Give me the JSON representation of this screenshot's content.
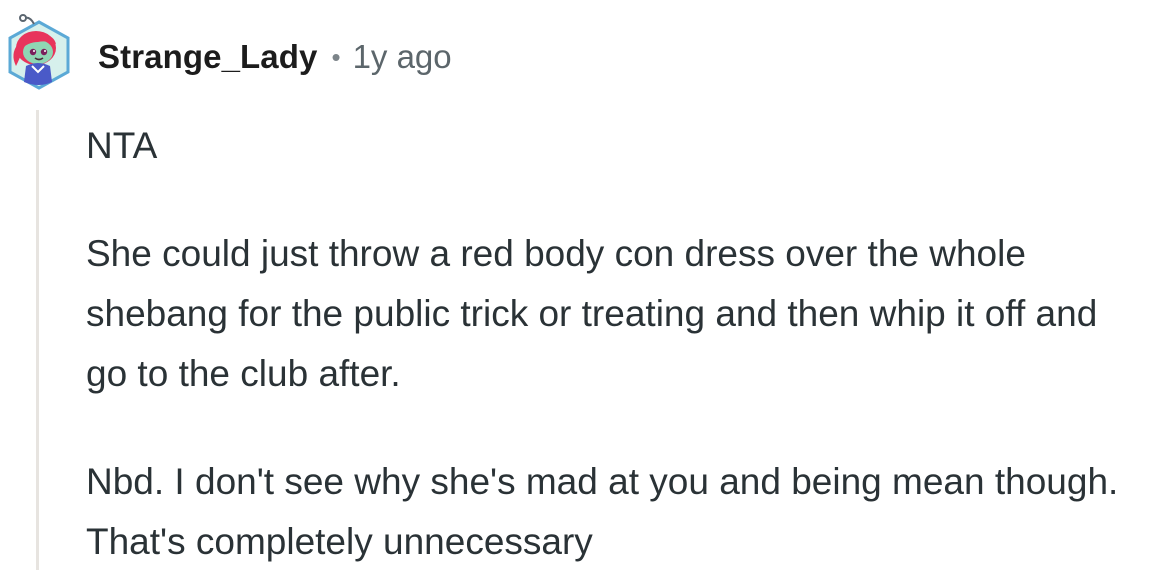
{
  "comment": {
    "username": "Strange_Lady",
    "separator": "•",
    "timestamp": "1y ago",
    "paragraphs": [
      "NTA",
      "She could just throw a red body con dress over the whole shebang for the public trick or treating and then whip it off and go to the club after.",
      "Nbd. I don't see why she's mad at you and being mean though. That's completely unnecessary"
    ]
  },
  "colors": {
    "username": "#1c1c1c",
    "timestamp": "#5c666b",
    "body_text": "#2a3236",
    "thread_line": "#e7e4e0",
    "avatar_hair": "#e8345c",
    "avatar_face": "#8fd6b4",
    "avatar_shirt": "#4a5ac8",
    "avatar_ring": "#5ba9d6"
  },
  "icons": {
    "avatar": "snoo-avatar-icon"
  }
}
